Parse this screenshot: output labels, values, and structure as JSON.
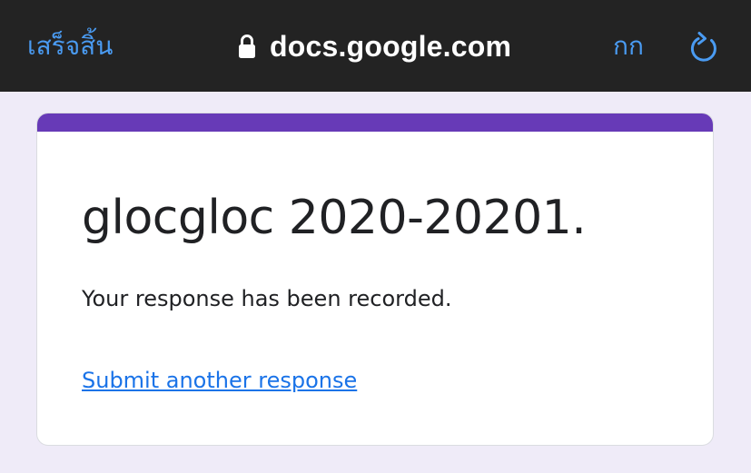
{
  "browser": {
    "done_label": "เสร็จสิ้น",
    "url": "docs.google.com",
    "text_size_label": "กก",
    "lock_icon": "lock-icon",
    "reload_icon": "reload-icon"
  },
  "form": {
    "title": "glocgloc 2020-20201.",
    "confirmation_message": "Your response has been recorded.",
    "submit_another_label": "Submit another response"
  },
  "colors": {
    "toolbar_bg": "#232323",
    "browser_accent": "#4a9bf2",
    "form_accent": "#673ab7",
    "page_bg": "#efebf8",
    "link": "#1a73e8"
  }
}
